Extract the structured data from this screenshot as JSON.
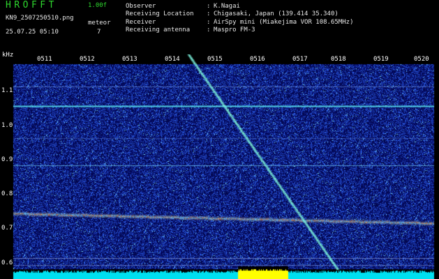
{
  "header": {
    "title": "HROFFT",
    "version": "1.00f",
    "filename": "KN9_2507250510.png",
    "datetime": "25.07.25 05:10",
    "meteor_label": "meteor",
    "meteor_count": "7"
  },
  "station_info": [
    {
      "key": "Observer",
      "value": "K.Nagai"
    },
    {
      "key": "Receiving Location",
      "value": "Chigasaki, Japan (139.414 35.340)"
    },
    {
      "key": "Receiver",
      "value": "AirSpy mini (Miakejima VOR 108.65MHz)"
    },
    {
      "key": "Receiving antenna",
      "value": "Maspro FM-3"
    }
  ],
  "separator": ":",
  "spectrogram": {
    "freq_unit": "kHz",
    "freq_ticks": [
      "1.1",
      "1.0",
      "0.9",
      "0.8",
      "0.7",
      "0.6"
    ],
    "time_ticks": [
      "0511",
      "0512",
      "0513",
      "0514",
      "0515",
      "0516",
      "0517",
      "0518",
      "0519",
      "0520"
    ],
    "freq_range_khz": [
      0.57,
      1.19
    ],
    "colors": {
      "background": "#000000",
      "noise_base": "#0a1590",
      "signal": "#30e0e0",
      "carrier": "#d8a040",
      "level_bar": "#00e0f0",
      "level_highlight": "#ffff00"
    }
  }
}
